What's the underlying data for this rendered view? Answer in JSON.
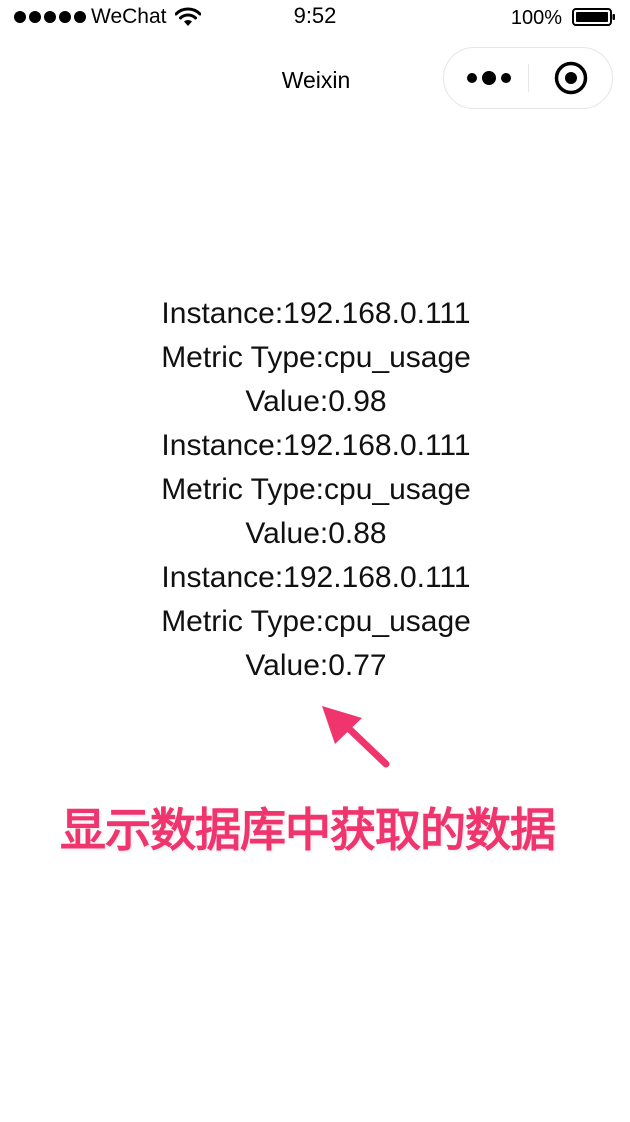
{
  "status_bar": {
    "carrier": "WeChat",
    "time": "9:52",
    "battery_percent": "100%",
    "signal_icon": "signal-dots-icon",
    "wifi_icon": "wifi-icon",
    "battery_icon": "battery-icon"
  },
  "nav": {
    "title": "Weixin",
    "more_icon": "more-dots-icon",
    "close_icon": "target-circle-icon"
  },
  "records": [
    {
      "instance": "Instance:192.168.0.111",
      "metric": "Metric Type:cpu_usage",
      "value": "Value:0.98"
    },
    {
      "instance": "Instance:192.168.0.111",
      "metric": "Metric Type:cpu_usage",
      "value": "Value:0.88"
    },
    {
      "instance": "Instance:192.168.0.111",
      "metric": "Metric Type:cpu_usage",
      "value": "Value:0.77"
    }
  ],
  "annotation": {
    "text": "显示数据库中获取的数据",
    "color": "#f0346e"
  }
}
